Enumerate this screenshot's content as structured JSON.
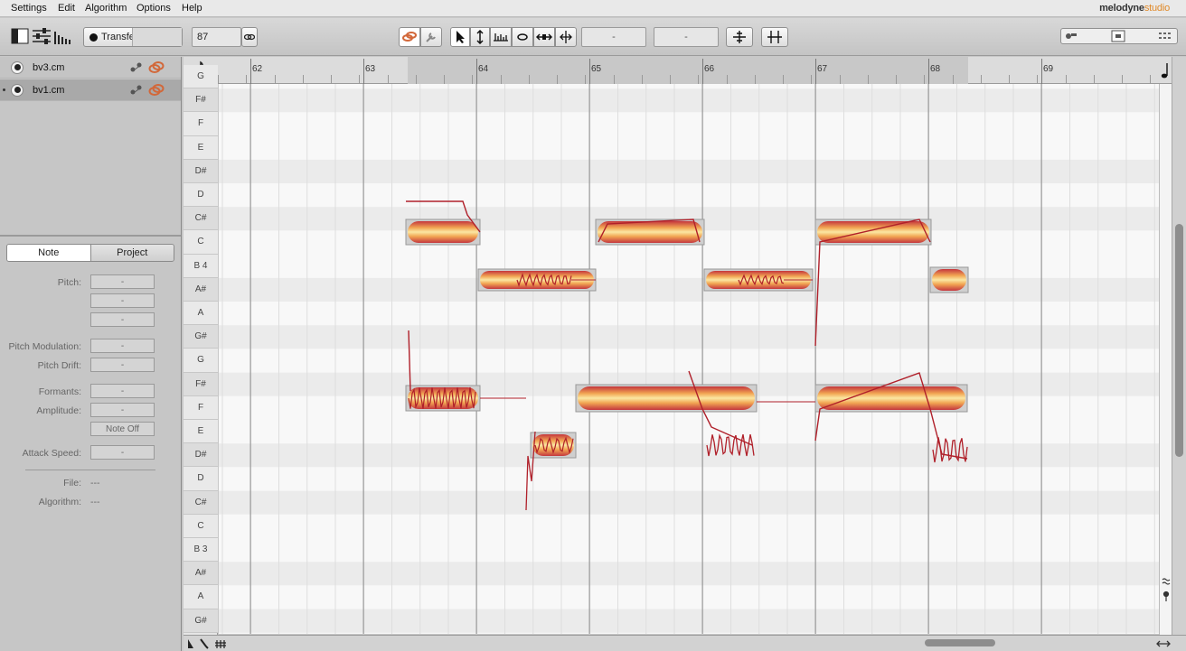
{
  "menu": [
    "Settings",
    "Edit",
    "Algorithm",
    "Options",
    "Help"
  ],
  "brand": {
    "main": "melodyne",
    "sub": "studio"
  },
  "toolbar": {
    "transfer_label": "Transfer",
    "tempo_value": "87",
    "pitch_field": "-",
    "time_field": "-"
  },
  "tracks": [
    {
      "name": "bv3.cm",
      "active": false
    },
    {
      "name": "bv1.cm",
      "active": true
    }
  ],
  "inspector": {
    "tabs": [
      "Note",
      "Project"
    ],
    "pitch_label": "Pitch:",
    "pitch_modulation_label": "Pitch Modulation:",
    "pitch_drift_label": "Pitch Drift:",
    "formants_label": "Formants:",
    "amplitude_label": "Amplitude:",
    "note_off_label": "Note Off",
    "attack_speed_label": "Attack Speed:",
    "file_label": "File:",
    "file_value": "---",
    "algorithm_label": "Algorithm:",
    "algorithm_value": "---",
    "dash": "-"
  },
  "pitch_keys": [
    "G",
    "F#",
    "F",
    "E",
    "D#",
    "D",
    "C#",
    "C",
    "B 4",
    "A#",
    "A",
    "G#",
    "G",
    "F#",
    "F",
    "E",
    "D#",
    "D",
    "C#",
    "C",
    "B 3",
    "A#",
    "A",
    "G#"
  ],
  "bars": [
    "62",
    "63",
    "64",
    "65",
    "66",
    "67",
    "68",
    "69"
  ],
  "colors": {
    "blob_core": "#fbe7a3",
    "blob_mid": "#f2a653",
    "blob_edge": "#c4363d",
    "pitch_line": "#b0202a",
    "selection": "#c9c9c9"
  }
}
